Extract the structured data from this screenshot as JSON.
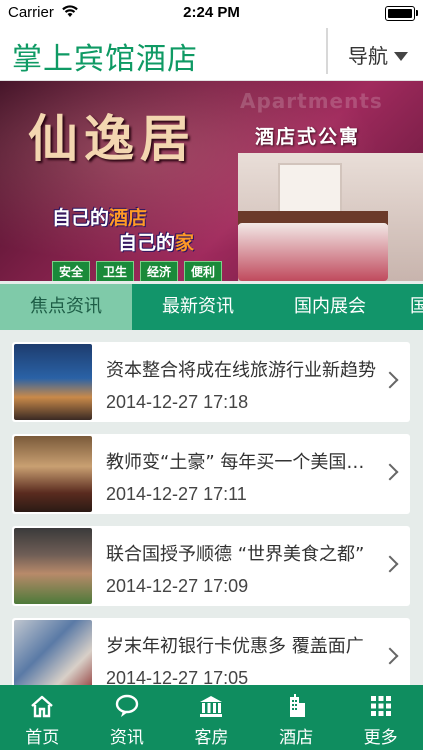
{
  "status_bar": {
    "carrier": "Carrier",
    "time": "2:24 PM"
  },
  "app": {
    "title": "掌上宾馆酒店",
    "nav_label": "导航"
  },
  "banner": {
    "brand": "仙逸居",
    "watermark": "Apartments",
    "subtitle": "酒店式公寓",
    "slogan_line1_a": "自己的",
    "slogan_line1_b": "酒店",
    "slogan_line2_a": "自己的",
    "slogan_line2_b": "家",
    "tags": [
      "安全",
      "卫生",
      "经济",
      "便利"
    ]
  },
  "tabs": [
    {
      "label": "焦点资讯",
      "active": true
    },
    {
      "label": "最新资讯",
      "active": false
    },
    {
      "label": "国内展会",
      "active": false
    },
    {
      "label": "国",
      "active": false
    }
  ],
  "news": [
    {
      "headline": "资本整合将成在线旅游行业新趋势",
      "date": "2014-12-27 17:18"
    },
    {
      "headline": "教师变“土豪” 每年买一个美国房子",
      "date": "2014-12-27 17:11"
    },
    {
      "headline": "联合国授予顺德 “世界美食之都”",
      "date": "2014-12-27 17:09"
    },
    {
      "headline": "岁末年初银行卡优惠多 覆盖面广",
      "date": "2014-12-27 17:05"
    }
  ],
  "bottom_nav": [
    {
      "label": "首页",
      "icon": "home-icon"
    },
    {
      "label": "资讯",
      "icon": "chat-bubble-icon"
    },
    {
      "label": "客房",
      "icon": "bank-building-icon"
    },
    {
      "label": "酒店",
      "icon": "hotel-building-icon"
    },
    {
      "label": "更多",
      "icon": "grid-icon"
    }
  ],
  "colors": {
    "brand_green": "#0f9a64",
    "tab_green": "#12956a",
    "active_tab": "#7fcaa9",
    "bottom_bar": "#0f8d5f"
  }
}
